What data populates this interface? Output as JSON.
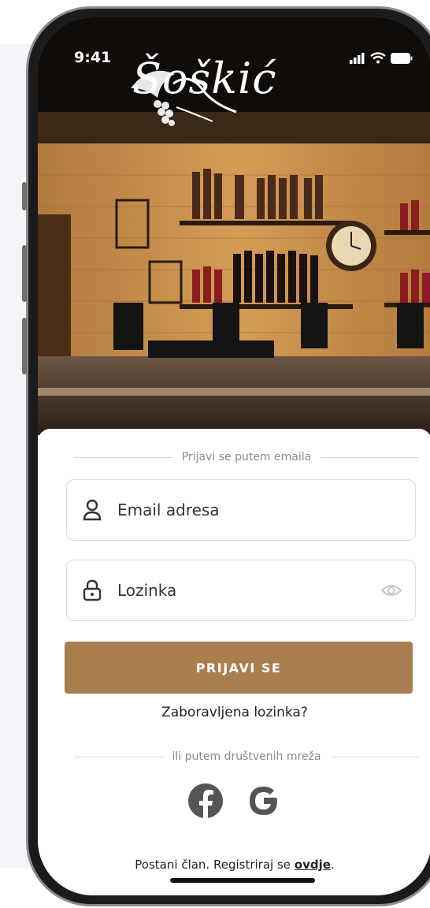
{
  "status_bar": {
    "time": "9:41"
  },
  "brand": {
    "name": "Šoškić"
  },
  "login": {
    "email_divider": "Prijavi se putem emaila",
    "email_placeholder": "Email adresa",
    "password_placeholder": "Lozinka",
    "submit_label": "PRIJAVI SE",
    "forgot_label": "Zaboravljena lozinka?",
    "social_divider": "ili putem društvenih mreža",
    "register_prefix": "Postani član. Registriraj se ",
    "register_link": "ovdje",
    "register_suffix": "."
  },
  "social": [
    {
      "name": "facebook",
      "icon": "facebook-icon"
    },
    {
      "name": "google",
      "icon": "google-icon"
    }
  ],
  "colors": {
    "accent": "#a87e4f",
    "icon_gray": "#555555"
  }
}
